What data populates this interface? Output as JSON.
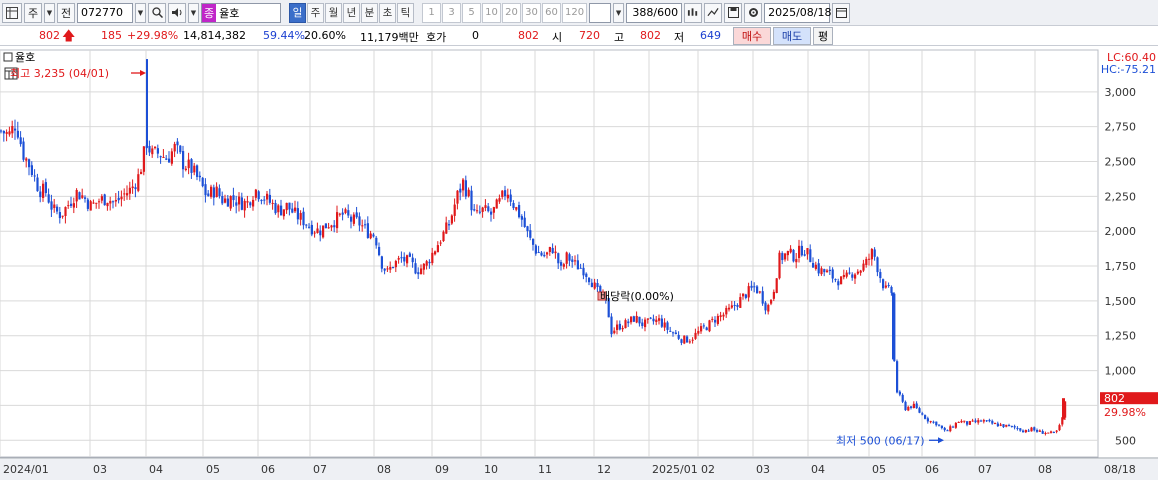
{
  "toolbar": {
    "menu_icon": "grid-menu-icon",
    "market_label": "주",
    "prev_label": "전",
    "code_value": "072770",
    "search_icon": "magnifier-icon",
    "speaker_icon": "speaker-icon",
    "stock_badge": "종",
    "stock_name": "율호",
    "periods": [
      "일",
      "주",
      "월",
      "년",
      "분",
      "초",
      "틱"
    ],
    "active_period": "일",
    "intervals": [
      "1",
      "3",
      "5",
      "10",
      "20",
      "30",
      "60",
      "120"
    ],
    "count_value": "388/600",
    "date_value": "2025/08/18"
  },
  "quote": {
    "price": "802",
    "change": "185",
    "change_pct": "+29.98%",
    "volume": "14,814,382",
    "volume_ratio": "59.44%",
    "turnover": "20.60%",
    "amount": "11,179백만",
    "hoga_label": "호가",
    "hoga_value": "0",
    "hoga_price": "802",
    "open_label": "시",
    "open": "720",
    "high_label": "고",
    "high": "802",
    "low_label": "저",
    "low": "649",
    "buy_label": "매수",
    "sell_label": "매도",
    "eval_label": "평"
  },
  "chart": {
    "legend_name": "율호",
    "lc_label": "LC:60.40",
    "hc_label": "HC:-75.21",
    "max_label": "최고 3,235 (04/01)",
    "min_label": "최저 500 (06/17)",
    "dividend_label": "배당락(0.00%)",
    "last_price": "802",
    "last_pct": "29.98%",
    "colors": {
      "up": "#e0191b",
      "down": "#1c4fd6",
      "grid": "#d9d9d9"
    }
  },
  "chart_data": {
    "type": "candlestick",
    "ylim": [
      380,
      3300
    ],
    "y_ticks": [
      3000,
      2750,
      2500,
      2250,
      2000,
      1750,
      1500,
      1250,
      1000,
      750,
      500
    ],
    "y_tick_labels": [
      "3,000",
      "2,750",
      "2,500",
      "2,250",
      "2,000",
      "1,750",
      "1,500",
      "1,250",
      "1,000",
      "",
      "500"
    ],
    "x_ticks": [
      "2024/01",
      "03",
      "04",
      "05",
      "06",
      "07",
      "08",
      "09",
      "10",
      "11",
      "12",
      "2025/01",
      "02",
      "03",
      "04",
      "05",
      "06",
      "07",
      "08",
      "08/18"
    ],
    "close_path": [
      [
        0,
        2720
      ],
      [
        8,
        2690
      ],
      [
        15,
        2780
      ],
      [
        22,
        2560
      ],
      [
        30,
        2450
      ],
      [
        38,
        2300
      ],
      [
        45,
        2280
      ],
      [
        52,
        2150
      ],
      [
        60,
        2120
      ],
      [
        68,
        2200
      ],
      [
        75,
        2280
      ],
      [
        82,
        2250
      ],
      [
        90,
        2180
      ],
      [
        98,
        2220
      ],
      [
        106,
        2240
      ],
      [
        114,
        2200
      ],
      [
        122,
        2260
      ],
      [
        130,
        2300
      ],
      [
        138,
        2400
      ],
      [
        146,
        2650
      ],
      [
        150,
        2550
      ],
      [
        158,
        2560
      ],
      [
        166,
        2520
      ],
      [
        174,
        2600
      ],
      [
        182,
        2490
      ],
      [
        190,
        2450
      ],
      [
        198,
        2360
      ],
      [
        206,
        2250
      ],
      [
        214,
        2300
      ],
      [
        222,
        2220
      ],
      [
        230,
        2240
      ],
      [
        238,
        2210
      ],
      [
        246,
        2200
      ],
      [
        254,
        2300
      ],
      [
        262,
        2250
      ],
      [
        270,
        2200
      ],
      [
        278,
        2150
      ],
      [
        286,
        2180
      ],
      [
        294,
        2120
      ],
      [
        302,
        2080
      ],
      [
        310,
        2030
      ],
      [
        318,
        2000
      ],
      [
        326,
        2050
      ],
      [
        334,
        2080
      ],
      [
        342,
        2120
      ],
      [
        350,
        2080
      ],
      [
        358,
        2060
      ],
      [
        366,
        2000
      ],
      [
        374,
        1970
      ],
      [
        380,
        1780
      ],
      [
        386,
        1700
      ],
      [
        392,
        1760
      ],
      [
        400,
        1800
      ],
      [
        408,
        1780
      ],
      [
        416,
        1720
      ],
      [
        424,
        1750
      ],
      [
        432,
        1850
      ],
      [
        440,
        1950
      ],
      [
        448,
        2050
      ],
      [
        456,
        2250
      ],
      [
        462,
        2350
      ],
      [
        468,
        2250
      ],
      [
        474,
        2100
      ],
      [
        482,
        2150
      ],
      [
        490,
        2120
      ],
      [
        498,
        2200
      ],
      [
        506,
        2300
      ],
      [
        512,
        2200
      ],
      [
        520,
        2100
      ],
      [
        528,
        1950
      ],
      [
        536,
        1850
      ],
      [
        544,
        1820
      ],
      [
        552,
        1880
      ],
      [
        560,
        1720
      ],
      [
        566,
        1820
      ],
      [
        574,
        1760
      ],
      [
        582,
        1730
      ],
      [
        590,
        1650
      ],
      [
        598,
        1540
      ],
      [
        606,
        1480
      ],
      [
        610,
        1280
      ],
      [
        618,
        1320
      ],
      [
        626,
        1340
      ],
      [
        634,
        1380
      ],
      [
        642,
        1330
      ],
      [
        650,
        1350
      ],
      [
        658,
        1360
      ],
      [
        666,
        1300
      ],
      [
        674,
        1260
      ],
      [
        682,
        1220
      ],
      [
        690,
        1230
      ],
      [
        698,
        1280
      ],
      [
        706,
        1320
      ],
      [
        714,
        1370
      ],
      [
        722,
        1400
      ],
      [
        730,
        1440
      ],
      [
        738,
        1500
      ],
      [
        746,
        1560
      ],
      [
        754,
        1600
      ],
      [
        760,
        1540
      ],
      [
        766,
        1440
      ],
      [
        772,
        1560
      ],
      [
        778,
        1800
      ],
      [
        786,
        1840
      ],
      [
        794,
        1820
      ],
      [
        802,
        1880
      ],
      [
        810,
        1800
      ],
      [
        818,
        1720
      ],
      [
        826,
        1700
      ],
      [
        834,
        1660
      ],
      [
        842,
        1640
      ],
      [
        850,
        1700
      ],
      [
        858,
        1720
      ],
      [
        866,
        1780
      ],
      [
        872,
        1860
      ],
      [
        878,
        1700
      ],
      [
        884,
        1580
      ],
      [
        892,
        1560
      ],
      [
        893,
        1080
      ],
      [
        896,
        850
      ],
      [
        904,
        730
      ],
      [
        912,
        750
      ],
      [
        920,
        690
      ],
      [
        928,
        640
      ],
      [
        936,
        620
      ],
      [
        944,
        560
      ],
      [
        950,
        590
      ],
      [
        958,
        640
      ],
      [
        966,
        620
      ],
      [
        974,
        630
      ],
      [
        982,
        640
      ],
      [
        990,
        620
      ],
      [
        998,
        610
      ],
      [
        1006,
        600
      ],
      [
        1014,
        590
      ],
      [
        1022,
        570
      ],
      [
        1030,
        580
      ],
      [
        1038,
        560
      ],
      [
        1046,
        555
      ],
      [
        1054,
        545
      ],
      [
        1060,
        617
      ],
      [
        1065,
        802
      ]
    ]
  }
}
